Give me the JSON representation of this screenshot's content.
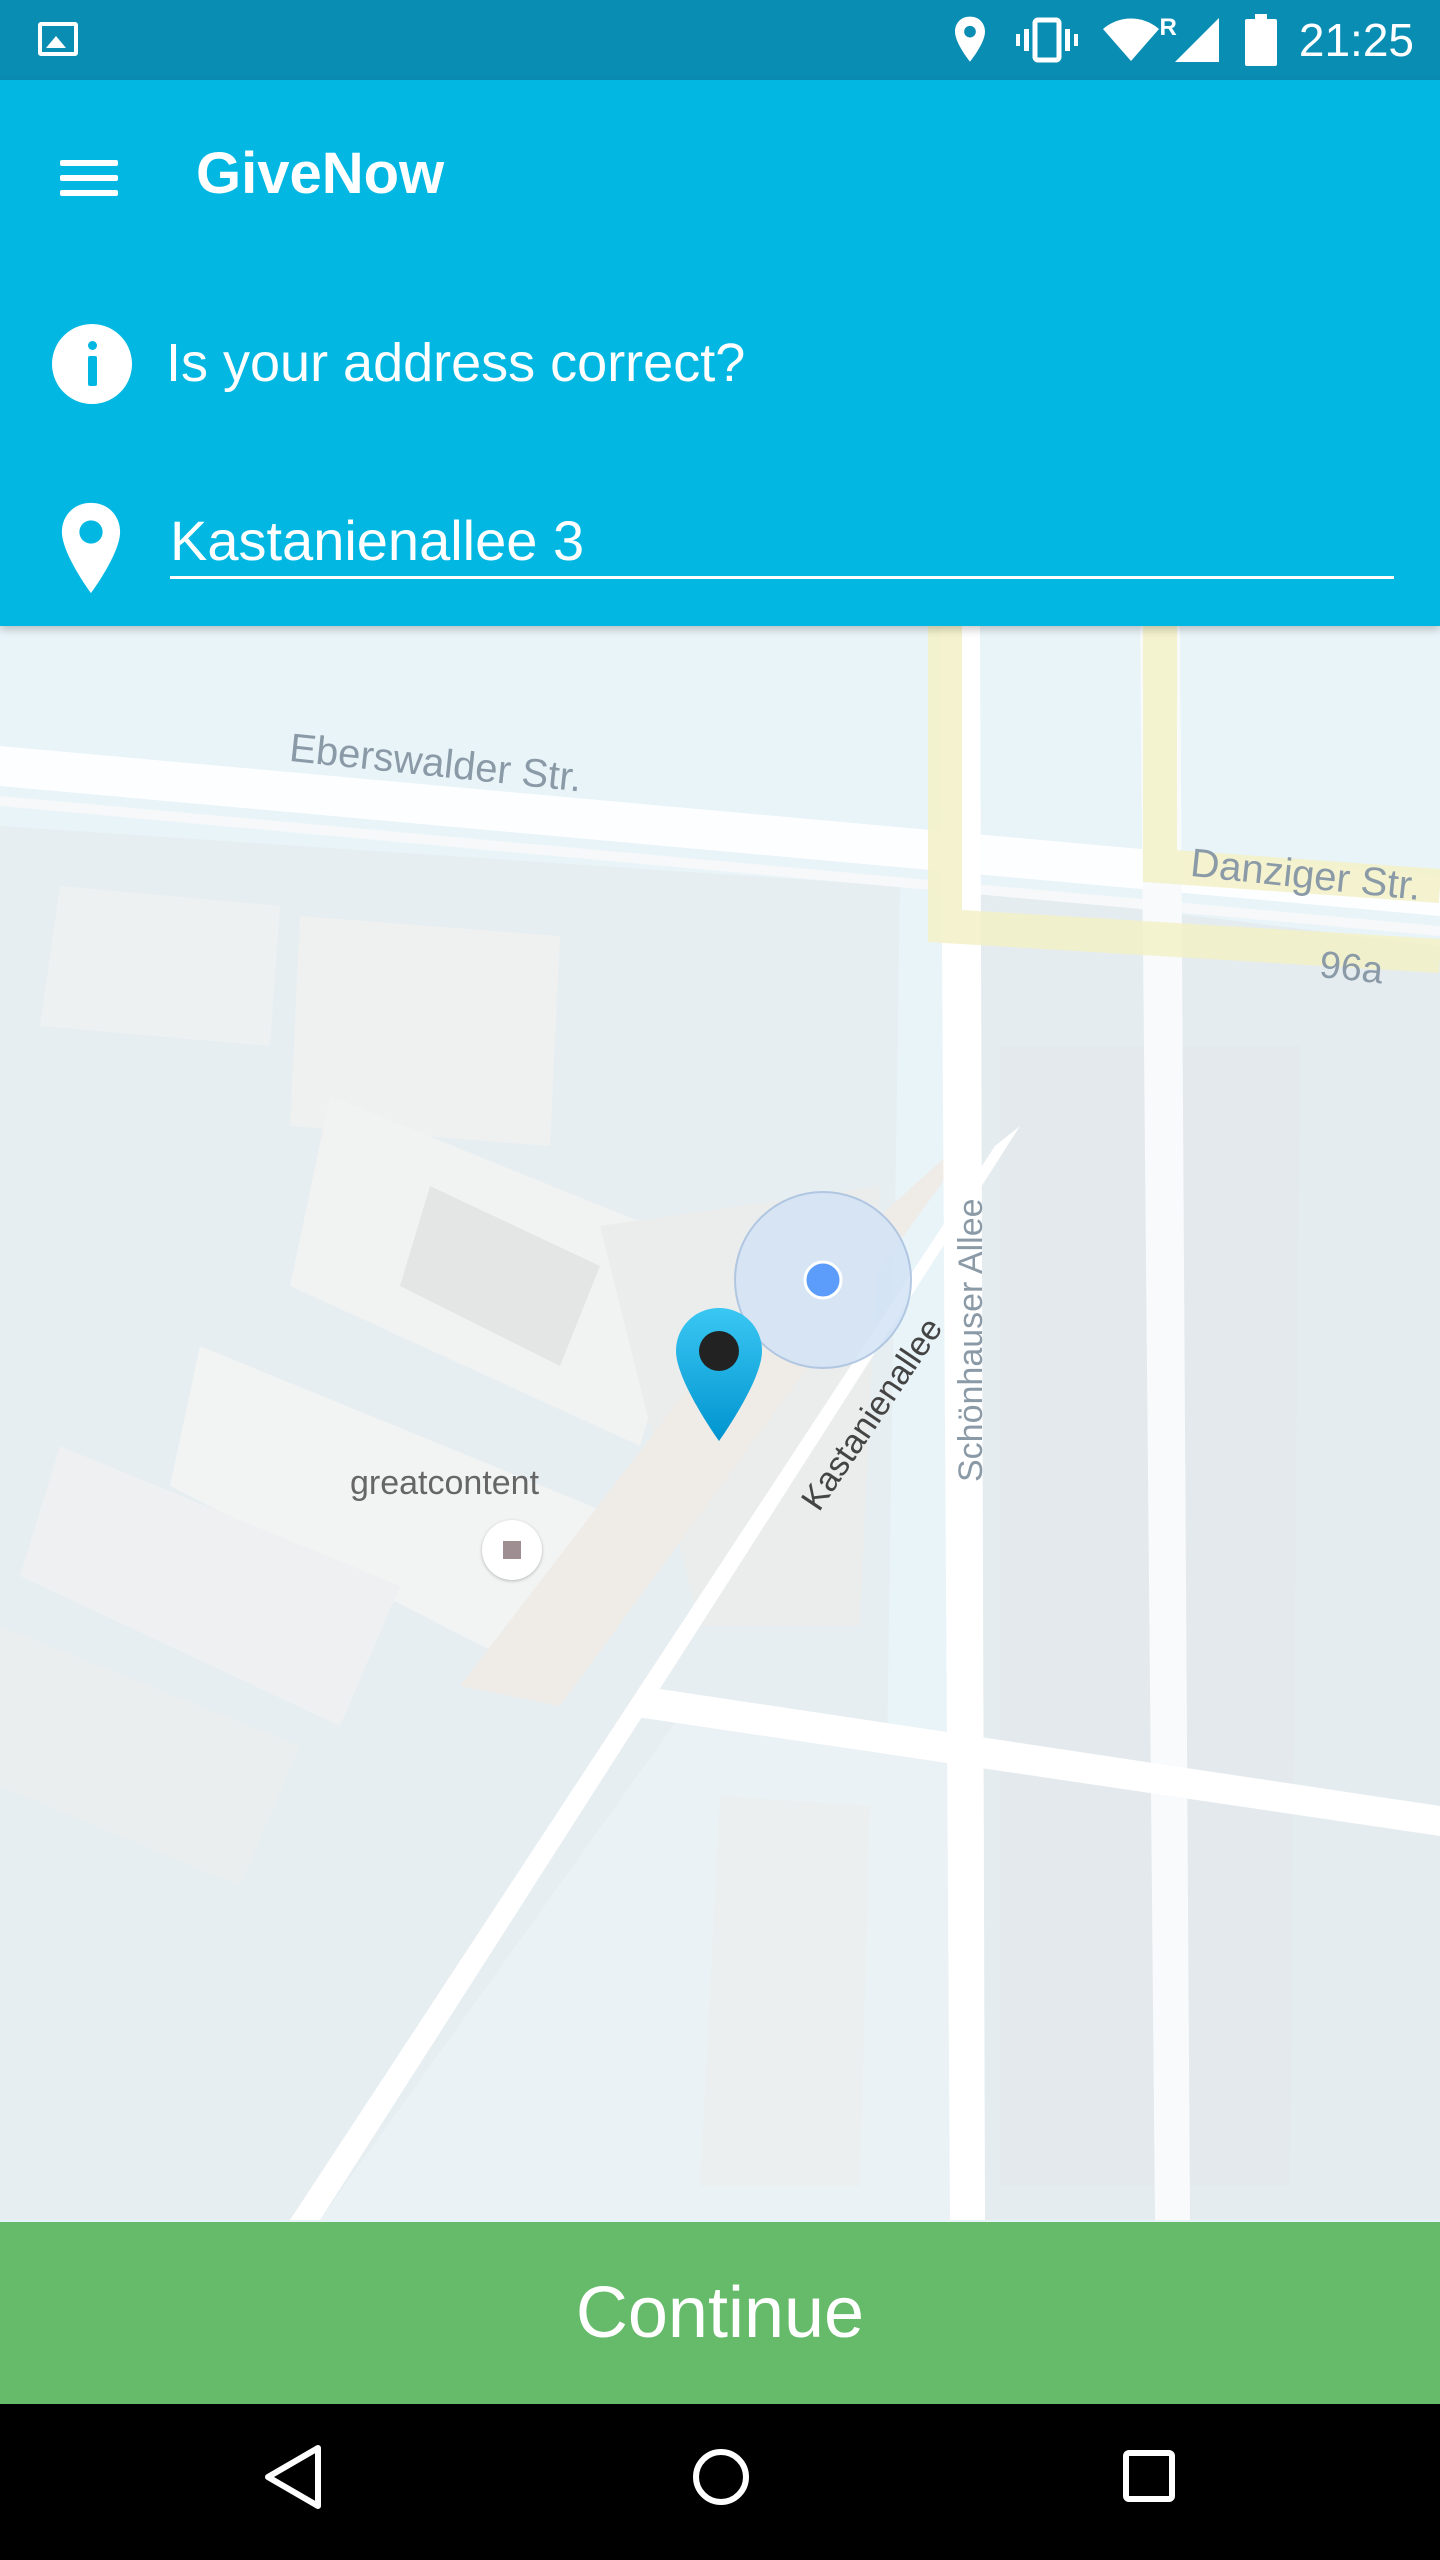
{
  "status_bar": {
    "time": "21:25",
    "icons": [
      "gallery-icon",
      "location-icon",
      "vibrate-icon",
      "wifi-icon",
      "signal-icon",
      "battery-icon"
    ],
    "roaming_indicator": "R"
  },
  "app_bar": {
    "title": "GiveNow",
    "info_text": "Is your address correct?",
    "address_value": "Kastanienallee 3"
  },
  "map": {
    "street_labels": [
      "Eberswalder Str.",
      "Danziger Str.",
      "96a",
      "Schönhauser Allee",
      "Kastanienallee"
    ],
    "poi_label": "greatcontent"
  },
  "actions": {
    "continue_label": "Continue"
  },
  "nav_bar": {
    "buttons": [
      "back-icon",
      "home-icon",
      "recents-icon"
    ]
  },
  "colors": {
    "status_bar": "#0a8db3",
    "app_bar": "#02b8e3",
    "continue": "#66bb6a",
    "map_bg": "#e8f3f8"
  }
}
